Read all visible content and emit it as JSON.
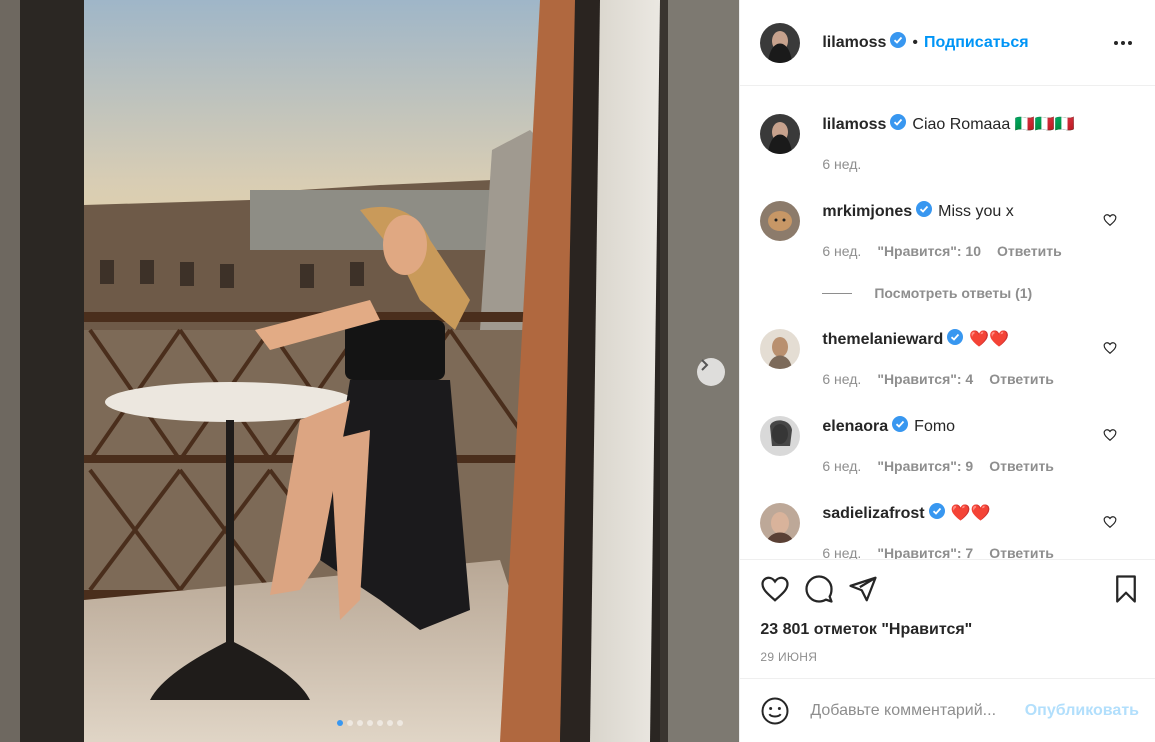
{
  "post": {
    "username": "lilamoss",
    "follow_label": "Подписаться",
    "separator": "•",
    "more_icon": "more-horizontal-icon",
    "caption": {
      "username": "lilamoss",
      "text": "Ciao Romaaa 🇮🇹🇮🇹🇮🇹",
      "age": "6 нед."
    },
    "comments": [
      {
        "username": "mrkimjones",
        "verified": true,
        "text": "Miss you x",
        "age": "6 нед.",
        "likes": "\"Нравится\": 10",
        "reply": "Ответить",
        "view_replies": "Посмотреть ответы (1)"
      },
      {
        "username": "themelanieward",
        "verified": true,
        "text": "❤️❤️",
        "age": "6 нед.",
        "likes": "\"Нравится\": 4",
        "reply": "Ответить"
      },
      {
        "username": "elenaora",
        "verified": true,
        "text": "Fomo",
        "age": "6 нед.",
        "likes": "\"Нравится\": 9",
        "reply": "Ответить"
      },
      {
        "username": "sadielizafrost",
        "verified": true,
        "text": "❤️❤️",
        "age": "6 нед.",
        "likes": "\"Нравится\": 7",
        "reply": "Ответить"
      }
    ],
    "likes_total": "23 801 отметок \"Нравится\"",
    "date": "29 ИЮНЯ",
    "comment_placeholder": "Добавьте комментарий...",
    "publish_label": "Опубликовать",
    "carousel": {
      "count": 7,
      "active_index": 0
    },
    "colors": {
      "accent": "#0095f6",
      "verified": "#3897f0",
      "muted": "#8e8e8e",
      "publish_disabled": "#b2dffc"
    }
  }
}
